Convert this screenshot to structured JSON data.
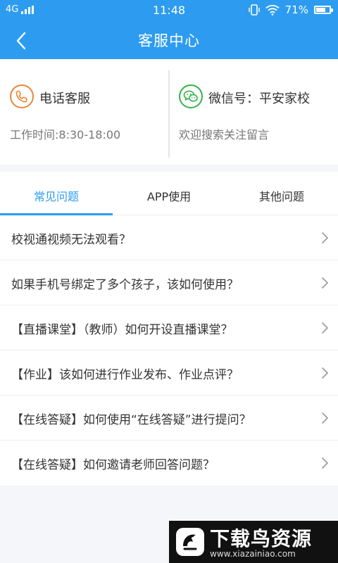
{
  "status_bar": {
    "network": "4G",
    "time": "11:48",
    "battery": "71%",
    "battery_level": 0.71
  },
  "nav": {
    "back_icon": "chevron-left-icon",
    "title": "客服中心"
  },
  "contact": {
    "phone": {
      "icon": "phone-icon",
      "title": "电话客服",
      "subtitle": "工作时间:8:30-18:00"
    },
    "wechat": {
      "icon": "wechat-icon",
      "title": "微信号：平安家校",
      "subtitle": "欢迎搜索关注留言"
    }
  },
  "tabs": [
    {
      "label": "常见问题",
      "active": true
    },
    {
      "label": "APP使用",
      "active": false
    },
    {
      "label": "其他问题",
      "active": false
    }
  ],
  "faq": [
    {
      "text": "校视通视频无法观看？"
    },
    {
      "text": "如果手机号绑定了多个孩子，该如何使用？"
    },
    {
      "text": "【直播课堂】（教师）如何开设直播课堂？"
    },
    {
      "text": "【作业】该如何进行作业发布、作业点评？"
    },
    {
      "text": "【在线答疑】如何使用“在线答疑”进行提问？"
    },
    {
      "text": "【在线答疑】如何邀请老师回答问题？"
    }
  ],
  "watermark": {
    "title": "下载鸟资源",
    "url": "www.xiazainiao.com"
  },
  "colors": {
    "primary": "#2d9cf0",
    "phone_accent": "#e8873a",
    "wechat_accent": "#34b34a"
  }
}
